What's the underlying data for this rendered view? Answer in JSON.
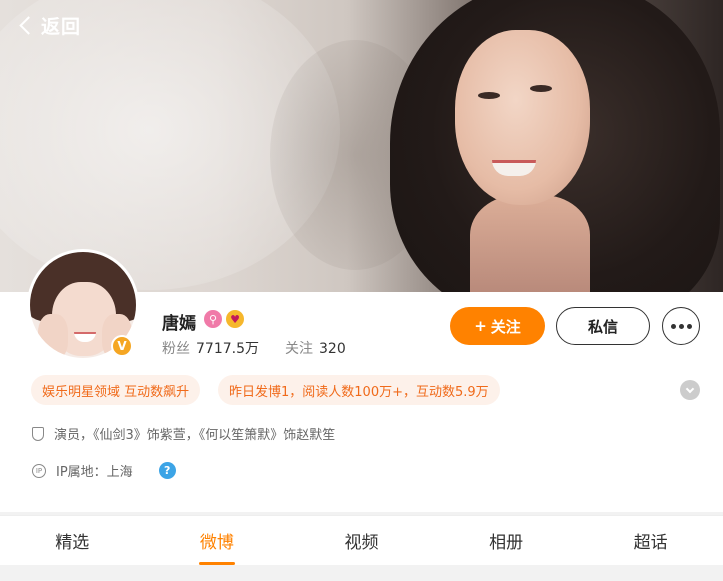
{
  "header": {
    "back_label": "返回"
  },
  "profile": {
    "name": "唐嫣",
    "fans_label": "粉丝",
    "fans_value": "7717.5万",
    "follow_label": "关注",
    "follow_value": "320",
    "verified_mark": "V"
  },
  "actions": {
    "follow_plus": "+",
    "follow": "关注",
    "message": "私信"
  },
  "tags": [
    "娱乐明星领域 互动数飙升",
    "昨日发博1，阅读人数100万+，互动数5.9万"
  ],
  "info": {
    "description": "演员，《仙剑3》饰紫萱，《何以笙箫默》饰赵默笙",
    "ip_icon_text": "IP",
    "ip_location": "IP属地：上海",
    "help": "?"
  },
  "tabs": [
    {
      "label": "精选",
      "active": false
    },
    {
      "label": "微博",
      "active": true
    },
    {
      "label": "视频",
      "active": false
    },
    {
      "label": "相册",
      "active": false
    },
    {
      "label": "超话",
      "active": false
    }
  ],
  "colors": {
    "accent": "#ff8200",
    "tag_bg": "#fdf1ea",
    "tag_text": "#f06a1a",
    "verified": "#f5a623"
  },
  "icons": [
    "back-chevron-icon",
    "verified-badge-icon",
    "search-badge-icon",
    "heart-eyes-badge-icon",
    "more-dots-icon",
    "expand-chevron-icon",
    "shield-icon",
    "ip-icon",
    "help-icon"
  ]
}
